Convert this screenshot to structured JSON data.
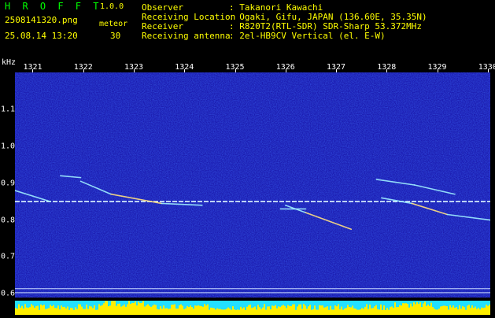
{
  "header": {
    "app_title": "H R O F F T",
    "app_version": "1.0.0",
    "file_name": "2508141320.png",
    "datetime": "25.08.14 13:20",
    "detection_kind": "meteor",
    "detection_count": "30",
    "info": [
      {
        "label": "Observer",
        "value": ": Takanori Kawachi"
      },
      {
        "label": "Receiving Location",
        "value": ": Ogaki, Gifu, JAPAN (136.60E, 35.35N)"
      },
      {
        "label": "Receiver",
        "value": ": R820T2(RTL-SDR) SDR-Sharp 53.372MHz"
      },
      {
        "label": "Receiving antenna",
        "value": ": 2el-HB9CV Vertical (el. E-W)"
      }
    ]
  },
  "chart_data": {
    "type": "heatmap",
    "title": "",
    "xlabel": "",
    "ylabel": "kHz",
    "x_ticks": [
      "1321",
      "1322",
      "1323",
      "1324",
      "1325",
      "1326",
      "1327",
      "1328",
      "1329",
      "1330"
    ],
    "y_ticks": [
      "1.1",
      "1.0",
      "0.9",
      "0.8",
      "0.7",
      "0.6"
    ],
    "xlim": [
      1320.65,
      1330.05
    ],
    "ylim": [
      0.59,
      1.2
    ],
    "carrier_khz": 0.85,
    "meteor_echoes": [
      {
        "x": [
          1320.65,
          1321.35
        ],
        "y": [
          0.88,
          0.85
        ]
      },
      {
        "x": [
          1321.55,
          1321.95
        ],
        "y": [
          0.92,
          0.915
        ]
      },
      {
        "x": [
          1321.95,
          1322.55
        ],
        "y": [
          0.905,
          0.87
        ]
      },
      {
        "x": [
          1322.55,
          1323.55
        ],
        "y": [
          0.87,
          0.845
        ]
      },
      {
        "x": [
          1323.55,
          1324.35
        ],
        "y": [
          0.845,
          0.84
        ]
      },
      {
        "x": [
          1325.9,
          1326.4
        ],
        "y": [
          0.83,
          0.83
        ]
      },
      {
        "x": [
          1326.0,
          1326.4
        ],
        "y": [
          0.84,
          0.82
        ]
      },
      {
        "x": [
          1326.4,
          1327.3
        ],
        "y": [
          0.82,
          0.775
        ]
      },
      {
        "x": [
          1327.8,
          1328.55
        ],
        "y": [
          0.91,
          0.895
        ]
      },
      {
        "x": [
          1328.55,
          1329.35
        ],
        "y": [
          0.895,
          0.87
        ]
      },
      {
        "x": [
          1327.9,
          1328.5
        ],
        "y": [
          0.86,
          0.845
        ]
      },
      {
        "x": [
          1328.5,
          1329.2
        ],
        "y": [
          0.845,
          0.815
        ]
      },
      {
        "x": [
          1329.2,
          1330.05
        ],
        "y": [
          0.815,
          0.8
        ]
      }
    ],
    "colors": {
      "background": "#1b1bb0",
      "carrier": "#e0f8ff",
      "echo": "#9fefff",
      "echo_hot": "#ffe080",
      "signal_fill": "#ffee00",
      "signal_low": "#22e0ff"
    }
  }
}
